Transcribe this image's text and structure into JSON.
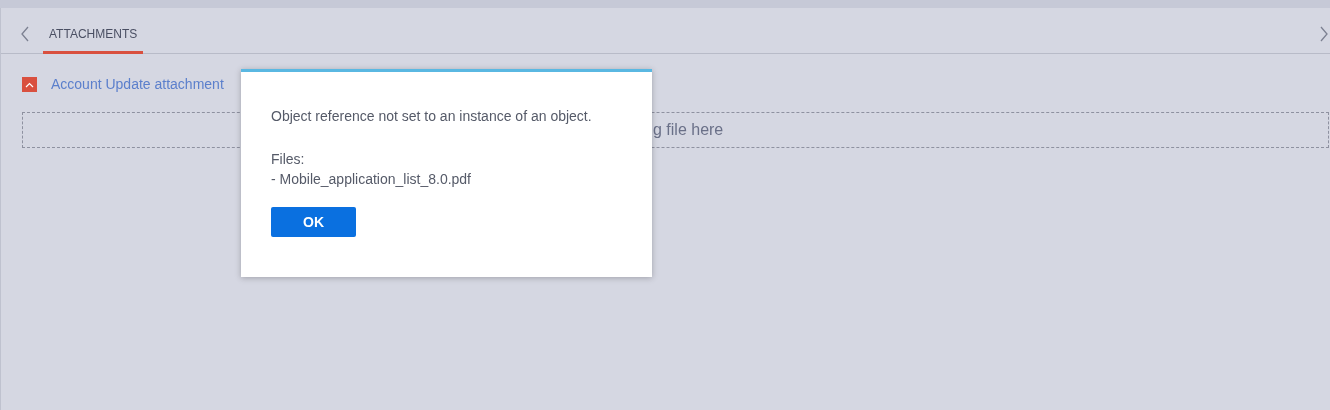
{
  "tabs": [
    {
      "label": "ATTACHMENTS",
      "selected": true
    }
  ],
  "attachment_group": {
    "title": "Account Update attachment",
    "expanded": true
  },
  "drop_zone": {
    "text": "g file here"
  },
  "dialog": {
    "message": "Object reference not set to an instance of an object.",
    "files_label": "Files:",
    "files": [
      "- Mobile_application_list_8.0.pdf"
    ],
    "button": "OK"
  }
}
